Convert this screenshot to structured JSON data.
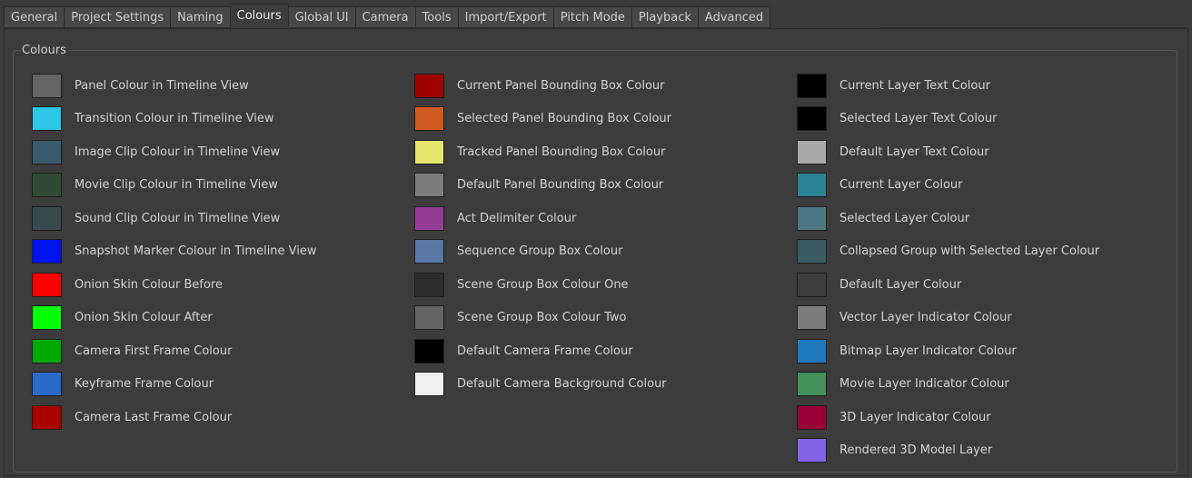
{
  "tabs": [
    {
      "label": "General"
    },
    {
      "label": "Project Settings"
    },
    {
      "label": "Naming"
    },
    {
      "label": "Colours",
      "active": true
    },
    {
      "label": "Global UI"
    },
    {
      "label": "Camera"
    },
    {
      "label": "Tools"
    },
    {
      "label": "Import/Export"
    },
    {
      "label": "Pitch Mode"
    },
    {
      "label": "Playback"
    },
    {
      "label": "Advanced"
    }
  ],
  "group_title": "Colours",
  "columns": [
    [
      {
        "label": "Panel Colour in Timeline View",
        "color": "#656565"
      },
      {
        "label": "Transition Colour in Timeline View",
        "color": "#2ec8e6"
      },
      {
        "label": "Image Clip Colour in Timeline View",
        "color": "#3a5a70"
      },
      {
        "label": "Movie Clip Colour in Timeline View",
        "color": "#2e4a35"
      },
      {
        "label": "Sound Clip Colour in Timeline View",
        "color": "#36494c"
      },
      {
        "label": "Snapshot Marker Colour in Timeline View",
        "color": "#0014f0"
      },
      {
        "label": "Onion Skin Colour Before",
        "color": "#ff0000"
      },
      {
        "label": "Onion Skin Colour After",
        "color": "#00ff00"
      },
      {
        "label": "Camera First Frame Colour",
        "color": "#00aa00"
      },
      {
        "label": "Keyframe Frame Colour",
        "color": "#2a6ac8"
      },
      {
        "label": "Camera Last Frame Colour",
        "color": "#aa0000"
      }
    ],
    [
      {
        "label": "Current Panel Bounding Box Colour",
        "color": "#a00000"
      },
      {
        "label": "Selected Panel Bounding Box Colour",
        "color": "#d05a20"
      },
      {
        "label": "Tracked Panel Bounding Box Colour",
        "color": "#e6e66e"
      },
      {
        "label": "Default Panel Bounding Box Colour",
        "color": "#7d7d7d"
      },
      {
        "label": "Act Delimiter Colour",
        "color": "#963c96"
      },
      {
        "label": "Sequence Group Box Colour",
        "color": "#5a78a5"
      },
      {
        "label": "Scene Group Box Colour One",
        "color": "#2d2d2d"
      },
      {
        "label": "Scene Group Box Colour Two",
        "color": "#646464"
      },
      {
        "label": "Default Camera Frame Colour",
        "color": "#000000"
      },
      {
        "label": "Default Camera Background Colour",
        "color": "#f0f0f0"
      }
    ],
    [
      {
        "label": "Current Layer Text Colour",
        "color": "#000000"
      },
      {
        "label": "Selected Layer Text Colour",
        "color": "#000000"
      },
      {
        "label": "Default Layer Text Colour",
        "color": "#aaaaaa"
      },
      {
        "label": "Current Layer Colour",
        "color": "#2d8296"
      },
      {
        "label": "Selected Layer Colour",
        "color": "#4b7882"
      },
      {
        "label": "Collapsed Group with Selected Layer Colour",
        "color": "#3a5a64"
      },
      {
        "label": "Default Layer Colour",
        "color": "#3c3c3c"
      },
      {
        "label": "Vector Layer Indicator Colour",
        "color": "#7d7d7d"
      },
      {
        "label": "Bitmap Layer Indicator Colour",
        "color": "#1e78be"
      },
      {
        "label": "Movie Layer Indicator Colour",
        "color": "#46915a"
      },
      {
        "label": "3D Layer Indicator Colour",
        "color": "#960037"
      },
      {
        "label": "Rendered 3D Model Layer",
        "color": "#8264e6"
      }
    ]
  ]
}
